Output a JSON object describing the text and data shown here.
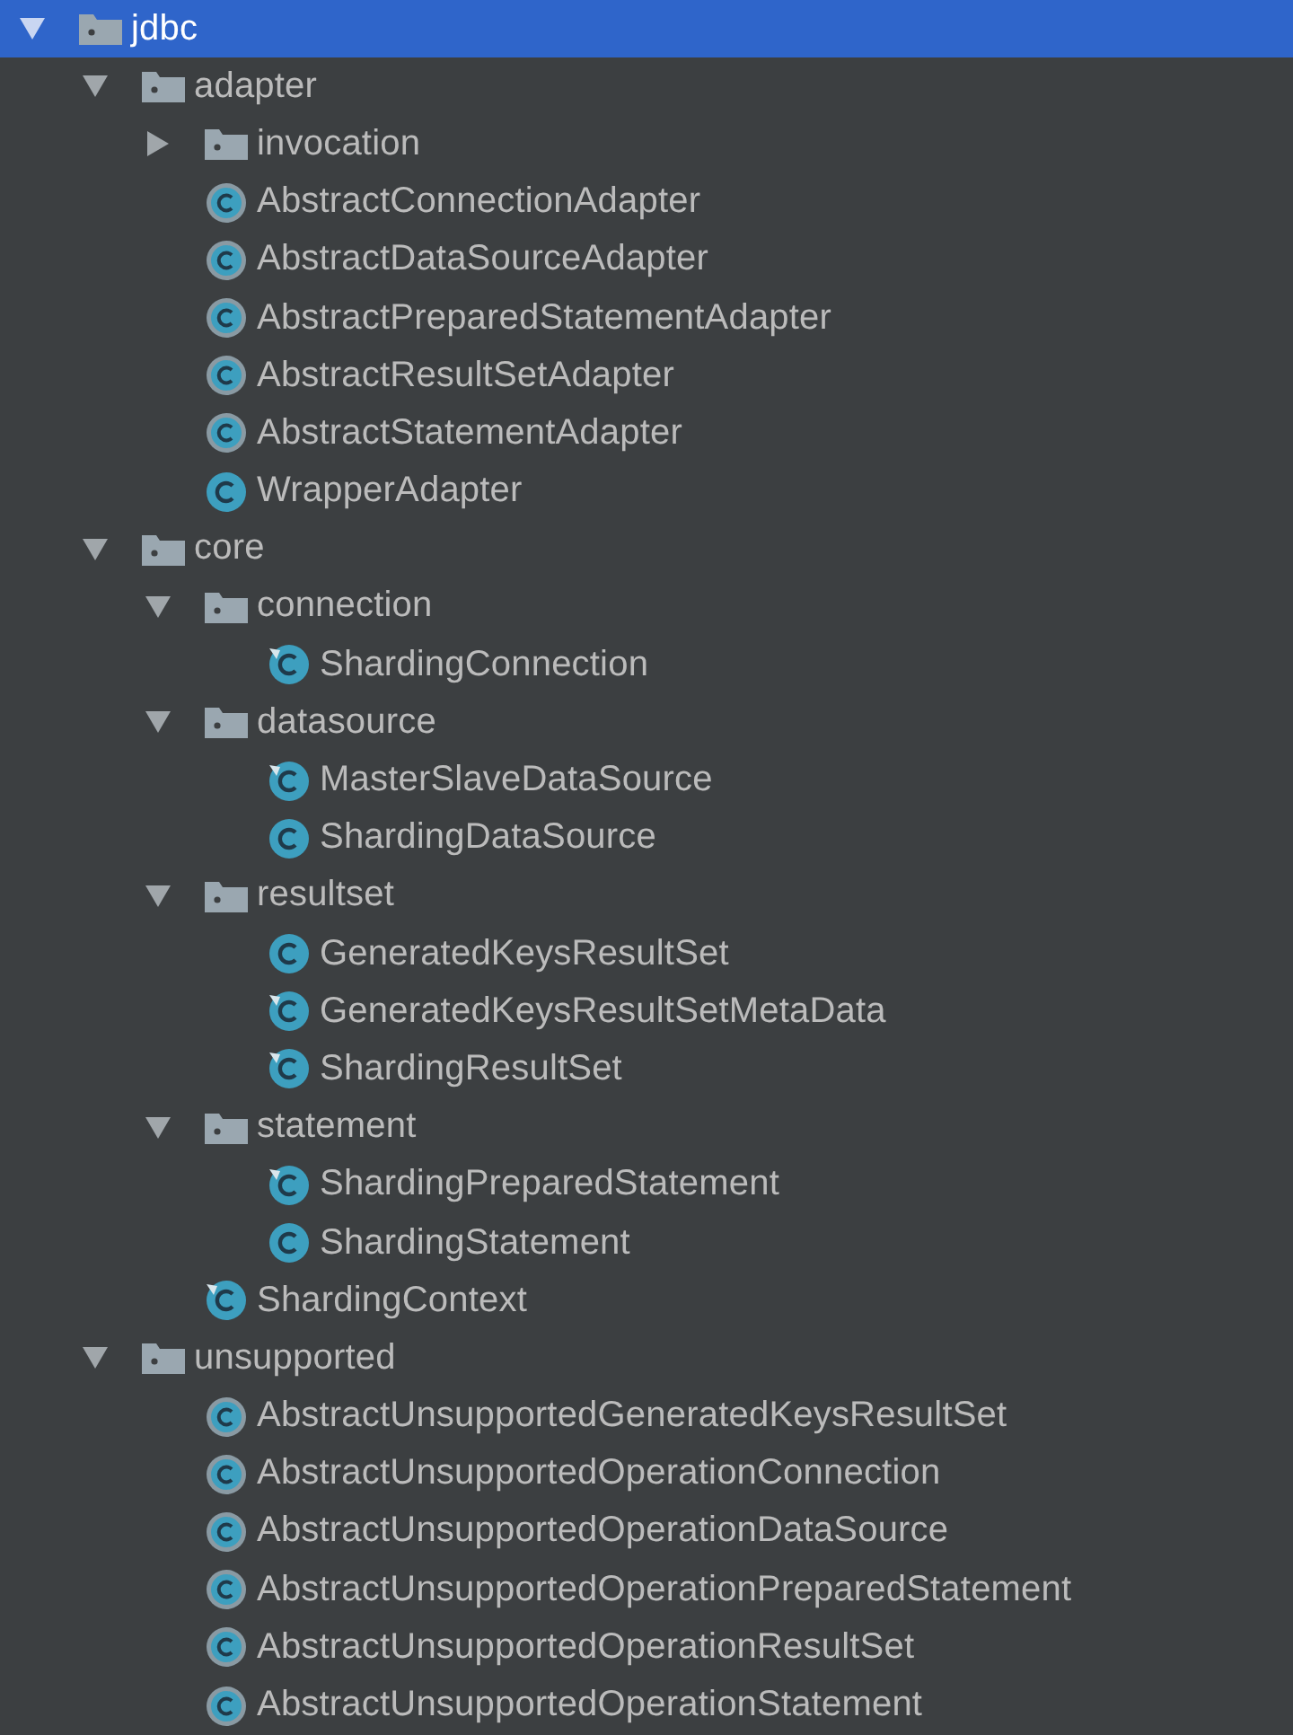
{
  "project_tree": {
    "items": [
      {
        "label": "jdbc",
        "kind": "folder",
        "expanded": true,
        "selected": true,
        "children": [
          {
            "label": "adapter",
            "kind": "folder",
            "expanded": true,
            "selected": false,
            "children": [
              {
                "label": "invocation",
                "kind": "folder",
                "expanded": false,
                "selected": false
              },
              {
                "label": "AbstractConnectionAdapter",
                "kind": "abstract-class",
                "selected": false
              },
              {
                "label": "AbstractDataSourceAdapter",
                "kind": "abstract-class",
                "selected": false
              },
              {
                "label": "AbstractPreparedStatementAdapter",
                "kind": "abstract-class",
                "selected": false
              },
              {
                "label": "AbstractResultSetAdapter",
                "kind": "abstract-class",
                "selected": false
              },
              {
                "label": "AbstractStatementAdapter",
                "kind": "abstract-class",
                "selected": false
              },
              {
                "label": "WrapperAdapter",
                "kind": "class",
                "selected": false
              }
            ]
          },
          {
            "label": "core",
            "kind": "folder",
            "expanded": true,
            "selected": false,
            "children": [
              {
                "label": "connection",
                "kind": "folder",
                "expanded": true,
                "selected": false,
                "children": [
                  {
                    "label": "ShardingConnection",
                    "kind": "class-marked",
                    "selected": false
                  }
                ]
              },
              {
                "label": "datasource",
                "kind": "folder",
                "expanded": true,
                "selected": false,
                "children": [
                  {
                    "label": "MasterSlaveDataSource",
                    "kind": "class-marked",
                    "selected": false
                  },
                  {
                    "label": "ShardingDataSource",
                    "kind": "class",
                    "selected": false
                  }
                ]
              },
              {
                "label": "resultset",
                "kind": "folder",
                "expanded": true,
                "selected": false,
                "children": [
                  {
                    "label": "GeneratedKeysResultSet",
                    "kind": "class",
                    "selected": false
                  },
                  {
                    "label": "GeneratedKeysResultSetMetaData",
                    "kind": "class-marked",
                    "selected": false
                  },
                  {
                    "label": "ShardingResultSet",
                    "kind": "class-marked",
                    "selected": false
                  }
                ]
              },
              {
                "label": "statement",
                "kind": "folder",
                "expanded": true,
                "selected": false,
                "children": [
                  {
                    "label": "ShardingPreparedStatement",
                    "kind": "class-marked",
                    "selected": false
                  },
                  {
                    "label": "ShardingStatement",
                    "kind": "class",
                    "selected": false
                  }
                ]
              },
              {
                "label": "ShardingContext",
                "kind": "class-marked",
                "selected": false
              }
            ]
          },
          {
            "label": "unsupported",
            "kind": "folder",
            "expanded": true,
            "selected": false,
            "children": [
              {
                "label": "AbstractUnsupportedGeneratedKeysResultSet",
                "kind": "abstract-class",
                "selected": false
              },
              {
                "label": "AbstractUnsupportedOperationConnection",
                "kind": "abstract-class",
                "selected": false
              },
              {
                "label": "AbstractUnsupportedOperationDataSource",
                "kind": "abstract-class",
                "selected": false
              },
              {
                "label": "AbstractUnsupportedOperationPreparedStatement",
                "kind": "abstract-class",
                "selected": false
              },
              {
                "label": "AbstractUnsupportedOperationResultSet",
                "kind": "abstract-class",
                "selected": false
              },
              {
                "label": "AbstractUnsupportedOperationStatement",
                "kind": "abstract-class",
                "selected": false
              }
            ]
          }
        ]
      }
    ]
  }
}
